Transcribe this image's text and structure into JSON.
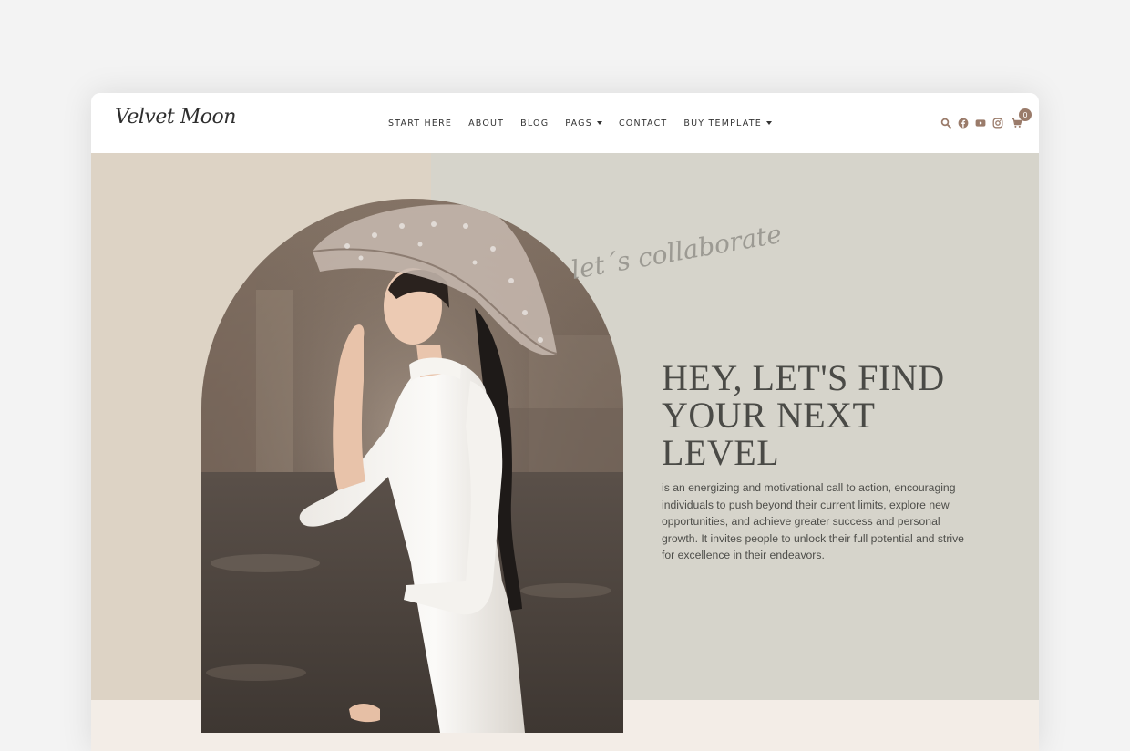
{
  "brand": {
    "logo_text": "Velvet Moon"
  },
  "nav": {
    "items": [
      {
        "label": "START HERE",
        "has_dropdown": false
      },
      {
        "label": "ABOUT",
        "has_dropdown": false
      },
      {
        "label": "BLOG",
        "has_dropdown": false
      },
      {
        "label": "PAGS",
        "has_dropdown": true
      },
      {
        "label": "CONTACT",
        "has_dropdown": false
      },
      {
        "label": "BUY TEMPLATE",
        "has_dropdown": true
      }
    ]
  },
  "header_icons": {
    "icons": [
      "search-icon",
      "facebook-icon",
      "youtube-icon",
      "instagram-icon",
      "cart-icon"
    ],
    "cart_count": "0"
  },
  "hero": {
    "script_text": "let´s collaborate",
    "headline_lines": [
      "HEY, LET'S FIND",
      "YOUR NEXT",
      "LEVEL"
    ],
    "body": "is an energizing and motivational call to action, encouraging individuals to push beyond their current limits, explore new opportunities, and achieve greater success and personal growth. It invites people to unlock their full potential and strive for excellence in their endeavors."
  },
  "colors": {
    "page_bg": "#f3f3f3",
    "panel_left": "#ddd3c5",
    "panel_right": "#d6d4cb",
    "bottom_strip": "#f3ede7",
    "accent": "#9a7b6a",
    "headline": "#4a4a46"
  }
}
